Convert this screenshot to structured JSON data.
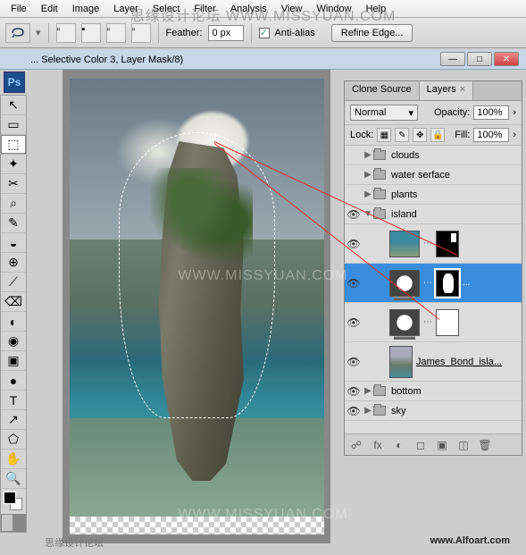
{
  "menubar": [
    "File",
    "Edit",
    "Image",
    "Layer",
    "Select",
    "Filter",
    "Analysis",
    "View",
    "Window",
    "Help"
  ],
  "options": {
    "feather_label": "Feather:",
    "feather_value": "0 px",
    "antialias_label": "Anti-alias",
    "antialias_checked": "✓",
    "refine_label": "Refine Edge..."
  },
  "window": {
    "title": "... Selective Color 3, Layer Mask/8)",
    "ps": "Ps",
    "min": "—",
    "max": "□",
    "close": "✕"
  },
  "tools": [
    "↖",
    "▭",
    "⬚",
    "✦",
    "✂",
    "⌕",
    "✎",
    "◒",
    "⊕",
    "⟋",
    "⌫",
    "◐",
    "◉",
    "▣",
    "●",
    "✎",
    "T",
    "↗",
    "⬠",
    "✋",
    "🔍",
    "⎇",
    "◧"
  ],
  "layers_panel": {
    "tabs": {
      "clone": "Clone Source",
      "layers": "Layers",
      "x": "×"
    },
    "blend_mode": "Normal",
    "opacity_label": "Opacity:",
    "opacity_value": "100%",
    "lock_label": "Lock:",
    "fill_label": "Fill:",
    "fill_value": "100%",
    "groups": {
      "clouds": "clouds",
      "water": "water serface",
      "plants": "plants",
      "island": "island",
      "bottom": "bottom",
      "sky": "sky"
    },
    "island_child": "James_Bond_isla...",
    "footer_icons": [
      "☍",
      "fx",
      "◐",
      "◻",
      "▣",
      "◫",
      "🗑"
    ]
  },
  "watermark": {
    "top": "思缘设计论坛  WWW.MISSYUAN.COM",
    "mid": "WWW.MISSYUAN.COM",
    "bot": "思缘设计论坛",
    "alfo": "www.Alfoart.com"
  }
}
